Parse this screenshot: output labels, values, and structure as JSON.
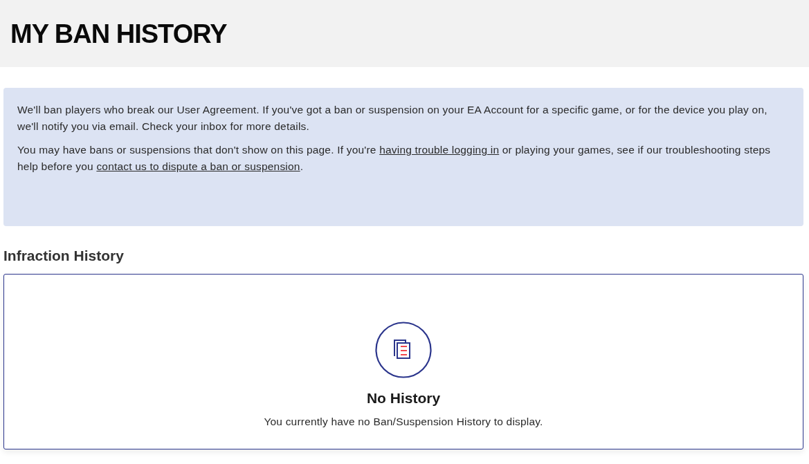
{
  "header": {
    "title": "MY BAN HISTORY"
  },
  "notice": {
    "paragraphs": [
      [
        {
          "kind": "text",
          "text": "We'll ban players who break our User Agreement. If you've got a ban or suspension on your EA Account for a specific game, or for the device you play on, we'll notify you via email. Check your inbox for more details."
        }
      ],
      [
        {
          "kind": "text",
          "text": "You may have bans or suspensions that don't show on this page. If you're "
        },
        {
          "kind": "link",
          "text": "having trouble logging in"
        },
        {
          "kind": "text",
          "text": " or playing your games, see if our troubleshooting steps help before you "
        },
        {
          "kind": "link",
          "text": "contact us to dispute a ban or suspension"
        },
        {
          "kind": "text",
          "text": "."
        }
      ]
    ]
  },
  "infraction_history": {
    "heading": "Infraction History",
    "empty_state": {
      "title": "No History",
      "message": "You currently have no Ban/Suspension History to display."
    }
  }
}
